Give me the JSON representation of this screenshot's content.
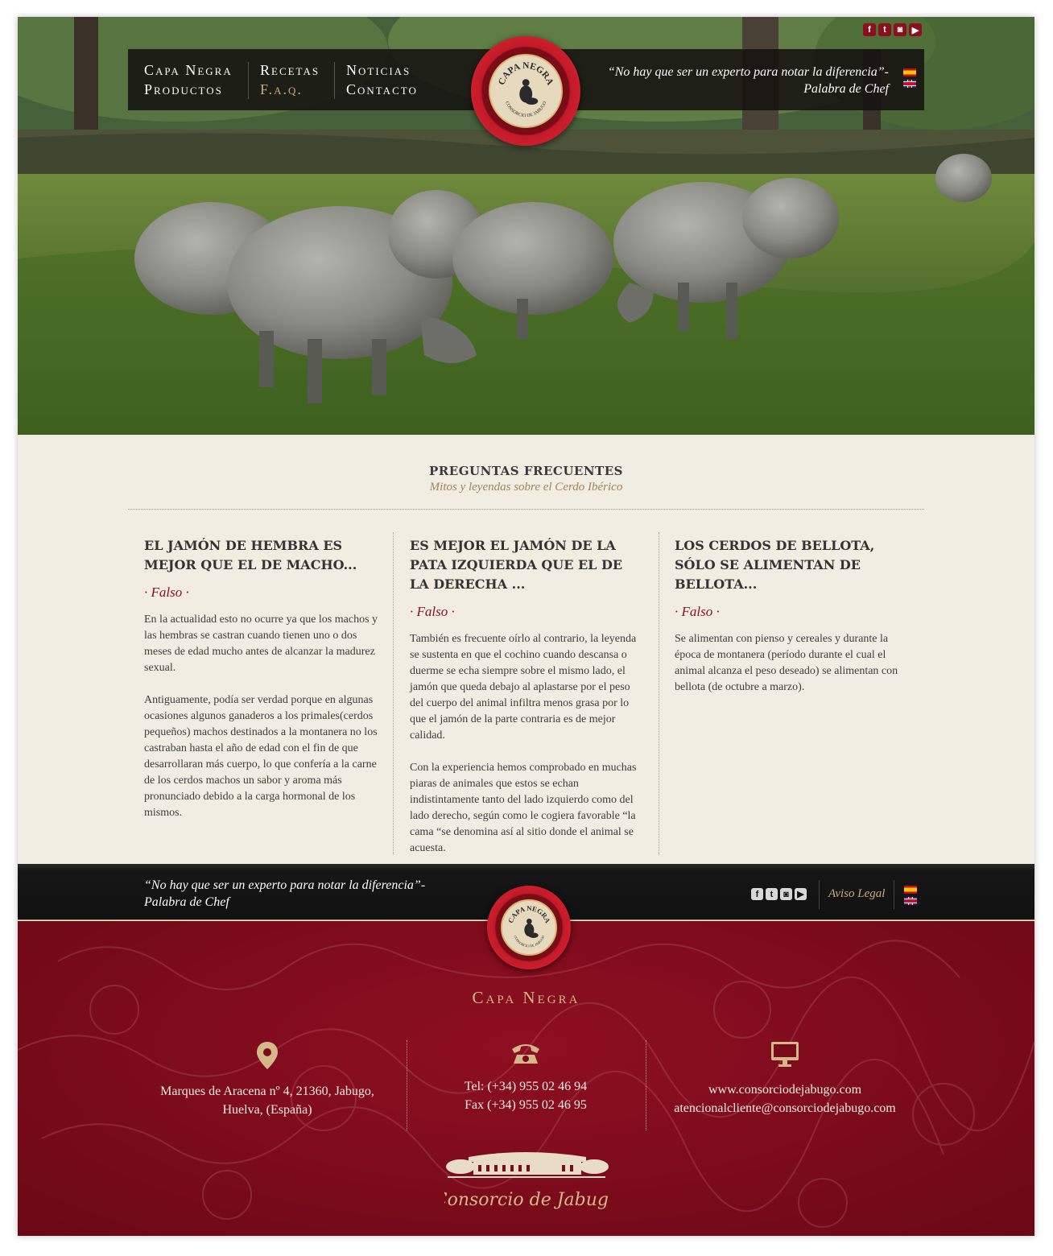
{
  "social": [
    "facebook-icon",
    "twitter-icon",
    "instagram-icon",
    "youtube-icon"
  ],
  "nav": {
    "col1": [
      "Capa Negra",
      "Productos"
    ],
    "col2": [
      "Recetas",
      "F.a.q."
    ],
    "col3": [
      "Noticias",
      "Contacto"
    ],
    "active": "F.a.q.",
    "quote_line1": "“No hay que ser un experto para notar la diferencia”-",
    "quote_line2": "Palabra de Chef"
  },
  "seal": {
    "top_text": "CAPA NEGRA",
    "bottom_text": "CONSORCIO DE JABUGO"
  },
  "faq": {
    "title": "PREGUNTAS FRECUENTES",
    "subtitle": "Mitos y leyendas sobre el Cerdo Ibérico",
    "items": [
      {
        "question": "EL JAMÓN DE HEMBRA ES MEJOR QUE EL DE MACHO...",
        "verdict": "· Falso ·",
        "paragraphs": [
          "En la actualidad esto no ocurre ya que los machos y las hembras se castran cuando tienen uno o dos meses de edad mucho antes de alcanzar la madurez sexual.",
          "Antiguamente, podía ser verdad porque en algunas ocasiones algunos ganaderos a los primales(cerdos pequeños) machos destinados a la montanera no los castraban hasta el año de edad con el fin de que desarrollaran más cuerpo, lo que confería a la carne de los cerdos machos un sabor y aroma más pronunciado debido a la carga hormonal de los mismos."
        ]
      },
      {
        "question": "ES MEJOR EL JAMÓN DE LA PATA IZQUIERDA QUE EL DE LA DERECHA ...",
        "verdict": "· Falso ·",
        "paragraphs": [
          "También es frecuente oírlo al contrario, la leyenda se sustenta en que el cochino cuando descansa o duerme se echa siempre sobre el mismo lado, el jamón que queda debajo al aplastarse por el peso del cuerpo del animal infiltra menos grasa por lo que el jamón de la parte contraria es de mejor calidad.",
          "Con la experiencia hemos comprobado en muchas piaras de animales que estos se echan indistintamente tanto del lado izquierdo como del lado derecho, según como le cogiera favorable “la cama “se denomina así al sitio donde el animal se acuesta."
        ]
      },
      {
        "question": "LOS CERDOS DE BELLOTA, SÓLO SE ALIMENTAN DE BELLOTA...",
        "verdict": "· Falso ·",
        "paragraphs": [
          "Se alimentan con pienso y cereales y durante la época de montanera (período durante el cual el animal alcanza el peso deseado) se alimentan con bellota (de octubre a marzo)."
        ]
      }
    ]
  },
  "footer": {
    "quote_line1": "“No hay que ser un experto para notar la diferencia”-",
    "quote_line2": "Palabra de Chef",
    "legal_link": "Aviso Legal",
    "brand": "Capa Negra",
    "address_line1": "Marques de Aracena nº 4, 21360, Jabugo,",
    "address_line2": "Huelva, (España)",
    "tel": "Tel: (+34) 955 02 46 94",
    "fax": "Fax (+34) 955 02 46 95",
    "web": "www.consorciodejabugo.com",
    "email": "atencionalcliente@consorciodejabugo.com",
    "company_logo": "Consorcio de Jabugo"
  },
  "colors": {
    "accent_red": "#8a1020",
    "gold": "#c9ab7c",
    "cream_bg": "#f2ede2"
  },
  "icons": {
    "address": "map-pin-icon",
    "phone": "telephone-icon",
    "web": "monitor-icon"
  }
}
